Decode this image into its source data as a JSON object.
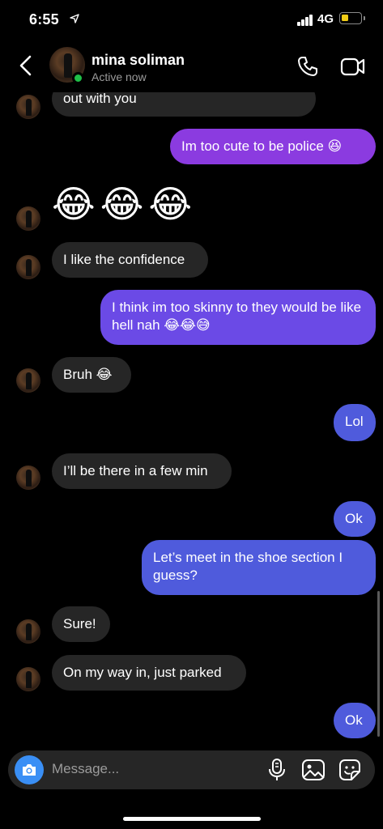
{
  "status_bar": {
    "time": "6:55",
    "network": "4G"
  },
  "header": {
    "name": "mina soliman",
    "status": "Active now"
  },
  "messages": [
    {
      "dir": "in",
      "text": "out with you"
    },
    {
      "dir": "out",
      "text": "Im too cute to be police 😆"
    },
    {
      "dir": "in",
      "text": "😂😂😂"
    },
    {
      "dir": "in",
      "text": "I like the confidence"
    },
    {
      "dir": "out",
      "text": "I think im too skinny to they would be like hell nah 😂😂😅"
    },
    {
      "dir": "in",
      "text": "Bruh 😂"
    },
    {
      "dir": "out",
      "text": "Lol"
    },
    {
      "dir": "in",
      "text": "I’ll be there in a few min"
    },
    {
      "dir": "out",
      "text": "Ok"
    },
    {
      "dir": "out",
      "text": "Let’s meet in the shoe section I guess?"
    },
    {
      "dir": "in",
      "text": "Sure!"
    },
    {
      "dir": "in",
      "text": "On my way in, just parked"
    },
    {
      "dir": "out",
      "text": "Ok"
    }
  ],
  "composer": {
    "placeholder": "Message..."
  },
  "colors": {
    "outgoing_purple": "#8b3be0",
    "outgoing_violet": "#6b4ae6",
    "outgoing_blue": "#4f5bdc",
    "incoming": "#262626",
    "online": "#1fbf48"
  }
}
